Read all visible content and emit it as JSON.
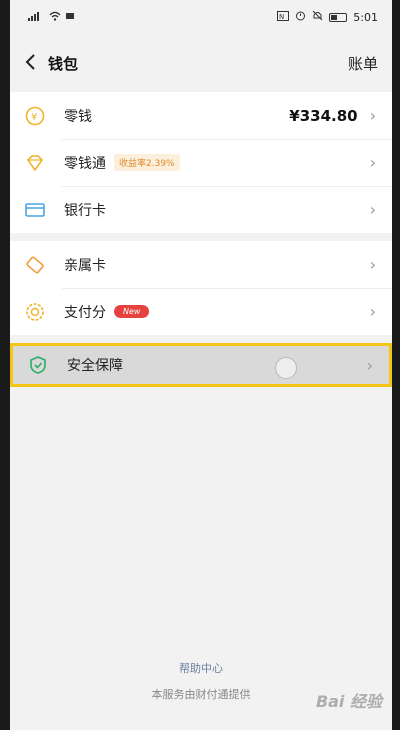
{
  "statusbar": {
    "time": "5:01",
    "left_icons": [
      "signal-icon",
      "wifi-icon",
      "battery-mini-icon"
    ],
    "right_icons": [
      "nfc-icon",
      "alarm-icon",
      "mute-icon",
      "battery-icon"
    ]
  },
  "nav": {
    "back_icon": "chevron-left-icon",
    "title": "钱包",
    "bill": "账单"
  },
  "groups": [
    [
      {
        "label": "零钱",
        "value": "¥334.80",
        "icon": "yuan-coin-icon"
      },
      {
        "label": "零钱通",
        "tag": "收益率2.39%",
        "icon": "diamond-icon"
      },
      {
        "label": "银行卡",
        "icon": "card-icon"
      }
    ],
    [
      {
        "label": "亲属卡",
        "icon": "family-card-icon"
      },
      {
        "label": "支付分",
        "badge": "New",
        "icon": "score-icon"
      }
    ],
    [
      {
        "label": "安全保障",
        "icon": "shield-icon"
      }
    ]
  ],
  "footer": {
    "help": "帮助中心",
    "provider": "本服务由财付通提供"
  },
  "watermark": "Bai 经验",
  "colors": {
    "accent_yellow": "#f5c518",
    "shield_green": "#2aae67",
    "card_blue": "#4aa3df",
    "new_red": "#e64340"
  }
}
